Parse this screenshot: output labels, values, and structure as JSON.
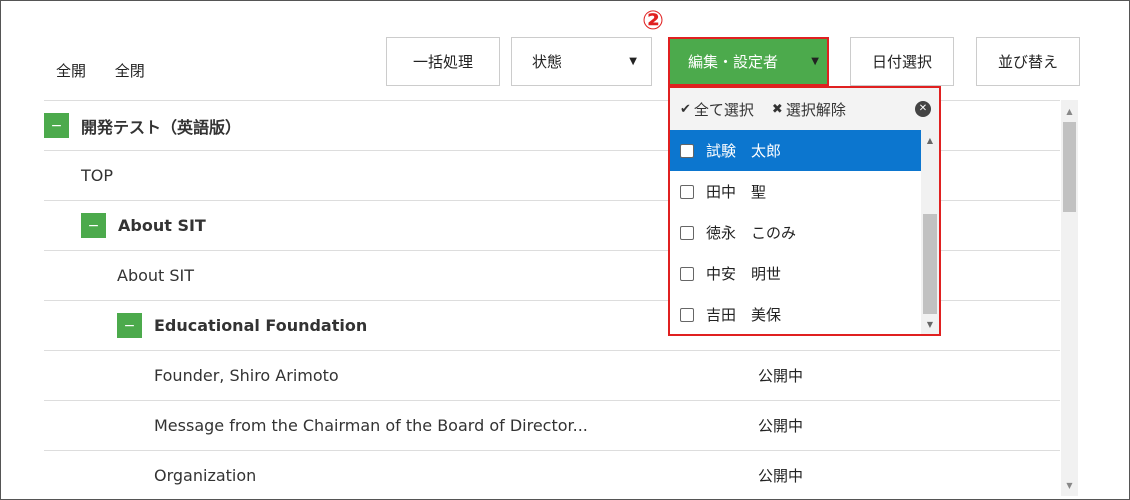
{
  "top_controls": {
    "expand_all": "全開",
    "collapse_all": "全閉"
  },
  "badge": "②",
  "toolbar": {
    "bulk": "一括処理",
    "status": "状態",
    "editor": "編集・設定者",
    "date": "日付選択",
    "sort": "並び替え"
  },
  "tree": [
    {
      "label": "開発テスト（英語版）",
      "status": ""
    },
    {
      "label": "TOP",
      "status": ""
    },
    {
      "label": "About SIT",
      "status": ""
    },
    {
      "label": "About SIT",
      "status": ""
    },
    {
      "label": "Educational Foundation",
      "status": ""
    },
    {
      "label": "Founder, Shiro Arimoto",
      "status": "公開中"
    },
    {
      "label": "Message from the Chairman of the Board of Director...",
      "status": "公開中"
    },
    {
      "label": "Organization",
      "status": "公開中"
    }
  ],
  "toggle_symbol": "−",
  "dropdown": {
    "select_all": "全て選択",
    "deselect": "選択解除",
    "items": [
      "試験　太郎",
      "田中　聖",
      "徳永　このみ",
      "中安　明世",
      "吉田　美保"
    ]
  },
  "colors": {
    "accent": "#4caa4c",
    "highlight": "#0c76cf",
    "callout": "#e02020"
  }
}
